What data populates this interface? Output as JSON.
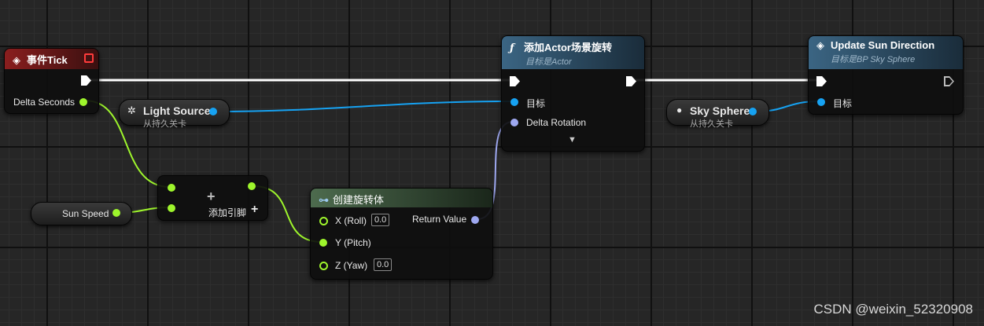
{
  "canvas": {
    "type": "blueprint-graph"
  },
  "nodes": {
    "event_tick": {
      "title": "事件Tick",
      "header_color": "#7a1a1a",
      "pins": {
        "delta_seconds": "Delta Seconds"
      }
    },
    "light_source": {
      "name": "Light Source",
      "subtitle": "从持久关卡"
    },
    "sky_sphere": {
      "name": "Sky Sphere",
      "subtitle": "从持久关卡"
    },
    "sun_speed": {
      "name": "Sun Speed"
    },
    "add": {
      "plus": "+",
      "add_pin_label": "添加引脚",
      "add_pin_plus": "+"
    },
    "make_rotator": {
      "title": "创建旋转体",
      "header_color": "#3b5b3c",
      "inputs": [
        {
          "label": "X (Roll)",
          "value": "0.0"
        },
        {
          "label": "Y (Pitch)"
        },
        {
          "label": "Z (Yaw)",
          "value": "0.0"
        }
      ],
      "output": "Return Value"
    },
    "add_actor_rotation": {
      "title": "添加Actor场景旋转",
      "subtitle": "目标是Actor",
      "header_color": "#2c4d66",
      "pins": {
        "target": "目标",
        "delta_rotation": "Delta Rotation"
      },
      "expand": "▼"
    },
    "update_sun": {
      "title": "Update Sun Direction",
      "subtitle": "目标是BP Sky Sphere",
      "header_color": "#2c4d66",
      "pins": {
        "target": "目标"
      }
    }
  },
  "icons": {
    "event": "diamond-icon",
    "function": "function-icon",
    "make": "make-struct-icon",
    "light": "light-icon",
    "sphere": "sphere-icon"
  },
  "colors": {
    "float_pin": "#9ef52c",
    "object_pin": "#16a2f2",
    "rotator_pin": "#9ea8f0",
    "exec_wire": "#ffffff"
  },
  "watermark": "CSDN @weixin_52320908"
}
